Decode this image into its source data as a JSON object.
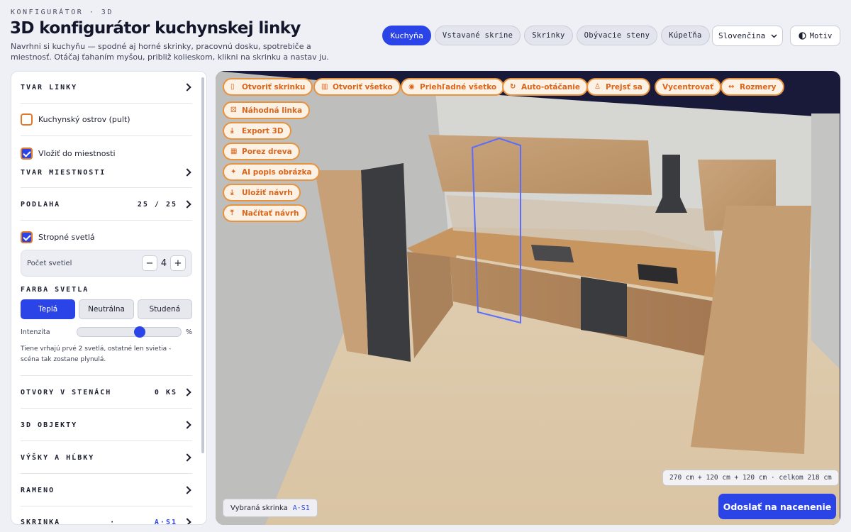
{
  "header": {
    "kicker": "KONFIGURÁTOR · 3D",
    "title": "3D konfigurátor kuchynskej linky",
    "subtitle": "Navrhni si kuchyňu — spodné aj horné skrinky, pracovnú dosku, spotrebiče a miestnosť. Otáčaj ťahaním myšou, približ kolieskom, klikni na skrinku a nastav ju."
  },
  "tabs": [
    {
      "label": "Kuchyňa",
      "active": true
    },
    {
      "label": "Vstavané skrine",
      "active": false
    },
    {
      "label": "Skrinky",
      "active": false
    },
    {
      "label": "Obývacie steny",
      "active": false
    },
    {
      "label": "Kúpeľňa",
      "active": false
    }
  ],
  "language": {
    "selected": "Slovenčina"
  },
  "theme": {
    "label": "Motiv"
  },
  "sidebar": {
    "tvar_linky": "TVAR LINKY",
    "island": {
      "label": "Kuchynský ostrov (pult)",
      "checked": false
    },
    "in_room": {
      "label": "Vložiť do miestnosti",
      "checked": true
    },
    "tvar_miestnosti": "TVAR MIESTNOSTI",
    "podlaha": {
      "label": "PODLAHA",
      "value": "25 / 25"
    },
    "ceiling_lights": {
      "label": "Stropné svetlá",
      "checked": true
    },
    "light_count": {
      "label": "Počet svetiel",
      "value": "4",
      "minus": "−",
      "plus": "+"
    },
    "light_color": {
      "label": "FARBA SVETLA",
      "options": [
        "Teplá",
        "Neutrálna",
        "Studená"
      ],
      "selected": "Teplá"
    },
    "intensity": {
      "label": "Intenzita",
      "unit": "%",
      "level": 0.6
    },
    "note": "Tiene vrhajú prvé 2 svetlá, ostatné len svietia - scéna tak zostane plynulá.",
    "otvory": {
      "label": "OTVORY V STENÁCH",
      "value": "0 KS"
    },
    "objekty": "3D OBJEKTY",
    "vysky": "VÝŠKY A HĹBKY",
    "rameno": "RAMENO",
    "skrinka": {
      "label": "SKRINKA",
      "sep": "·",
      "value": "A·S1"
    }
  },
  "viewport": {
    "buttons": [
      {
        "label": "Otvoriť skrinku",
        "icon": "door-icon"
      },
      {
        "label": "Otvoriť všetko",
        "icon": "doors-icon"
      },
      {
        "label": "Priehľadné všetko",
        "icon": "eye-icon"
      },
      {
        "label": "Auto-otáčanie",
        "icon": "rotate-icon"
      },
      {
        "label": "Prejsť sa",
        "icon": "walk-icon"
      },
      {
        "label": "Vycentrovať",
        "icon": "center-icon"
      },
      {
        "label": "Rozmery",
        "icon": "ruler-icon"
      },
      {
        "label": "Náhodná linka",
        "icon": "dice-icon"
      },
      {
        "label": "Export 3D",
        "icon": "download-icon"
      },
      {
        "label": "Porez dreva",
        "icon": "grid-icon"
      },
      {
        "label": "AI popis obrázka",
        "icon": "sparkle-icon"
      },
      {
        "label": "Uložiť návrh",
        "icon": "save-icon"
      },
      {
        "label": "Načítať návrh",
        "icon": "upload-icon"
      }
    ],
    "dimensions": "270 cm + 120 cm + 120 cm · celkom 218 cm",
    "selected_label": "Vybraná skrinka",
    "selected_code": "A·S1",
    "submit": "Odoslať na nacenenie"
  }
}
